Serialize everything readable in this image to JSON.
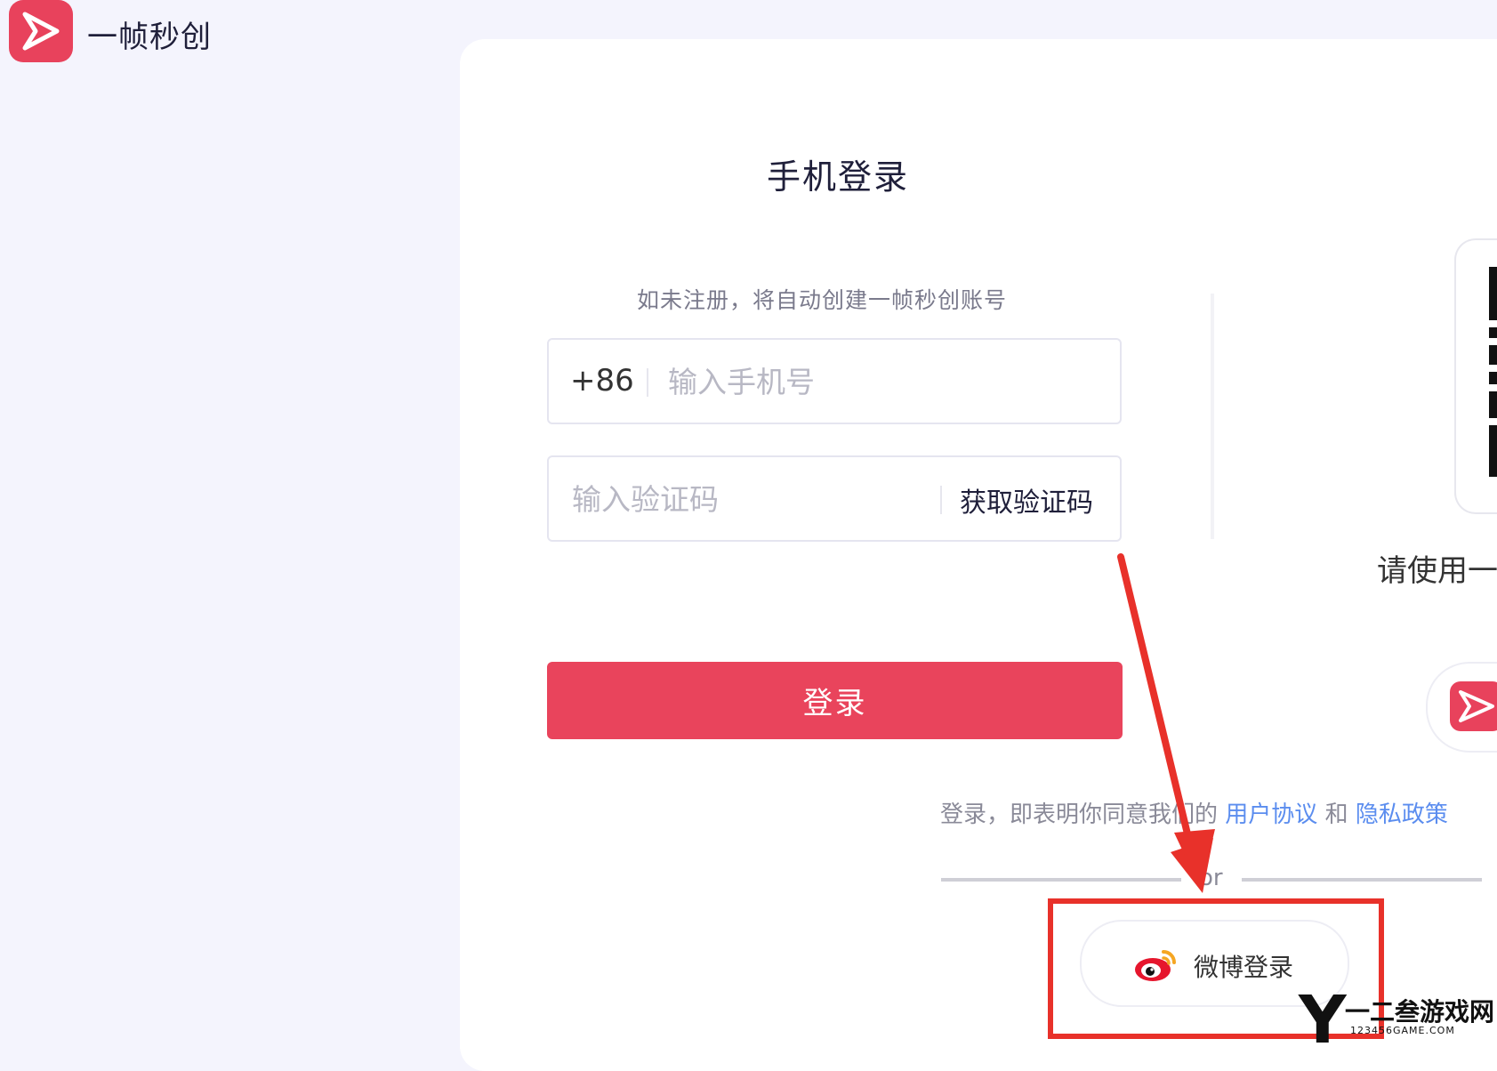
{
  "header": {
    "brand": "一帧秒创"
  },
  "login": {
    "title": "手机登录",
    "hint": "如未注册，将自动创建一帧秒创账号",
    "phone_prefix": "+86",
    "phone_placeholder": "输入手机号",
    "code_placeholder": "输入验证码",
    "get_code_label": "获取验证码",
    "login_label": "登录",
    "agreement_prefix": "登录，即表明你同意我们的",
    "user_agreement": "用户协议",
    "and": "和",
    "privacy_policy": "隐私政策",
    "or": "or",
    "weibo_label": "微博登录"
  },
  "qr": {
    "instruction": "请使用一"
  },
  "watermark": {
    "letter": "Y",
    "name": "一二叁游戏网",
    "url": "123456GAME.COM"
  },
  "colors": {
    "brand": "#e8425c",
    "annotation": "#e8312a",
    "link": "#5b8def"
  }
}
